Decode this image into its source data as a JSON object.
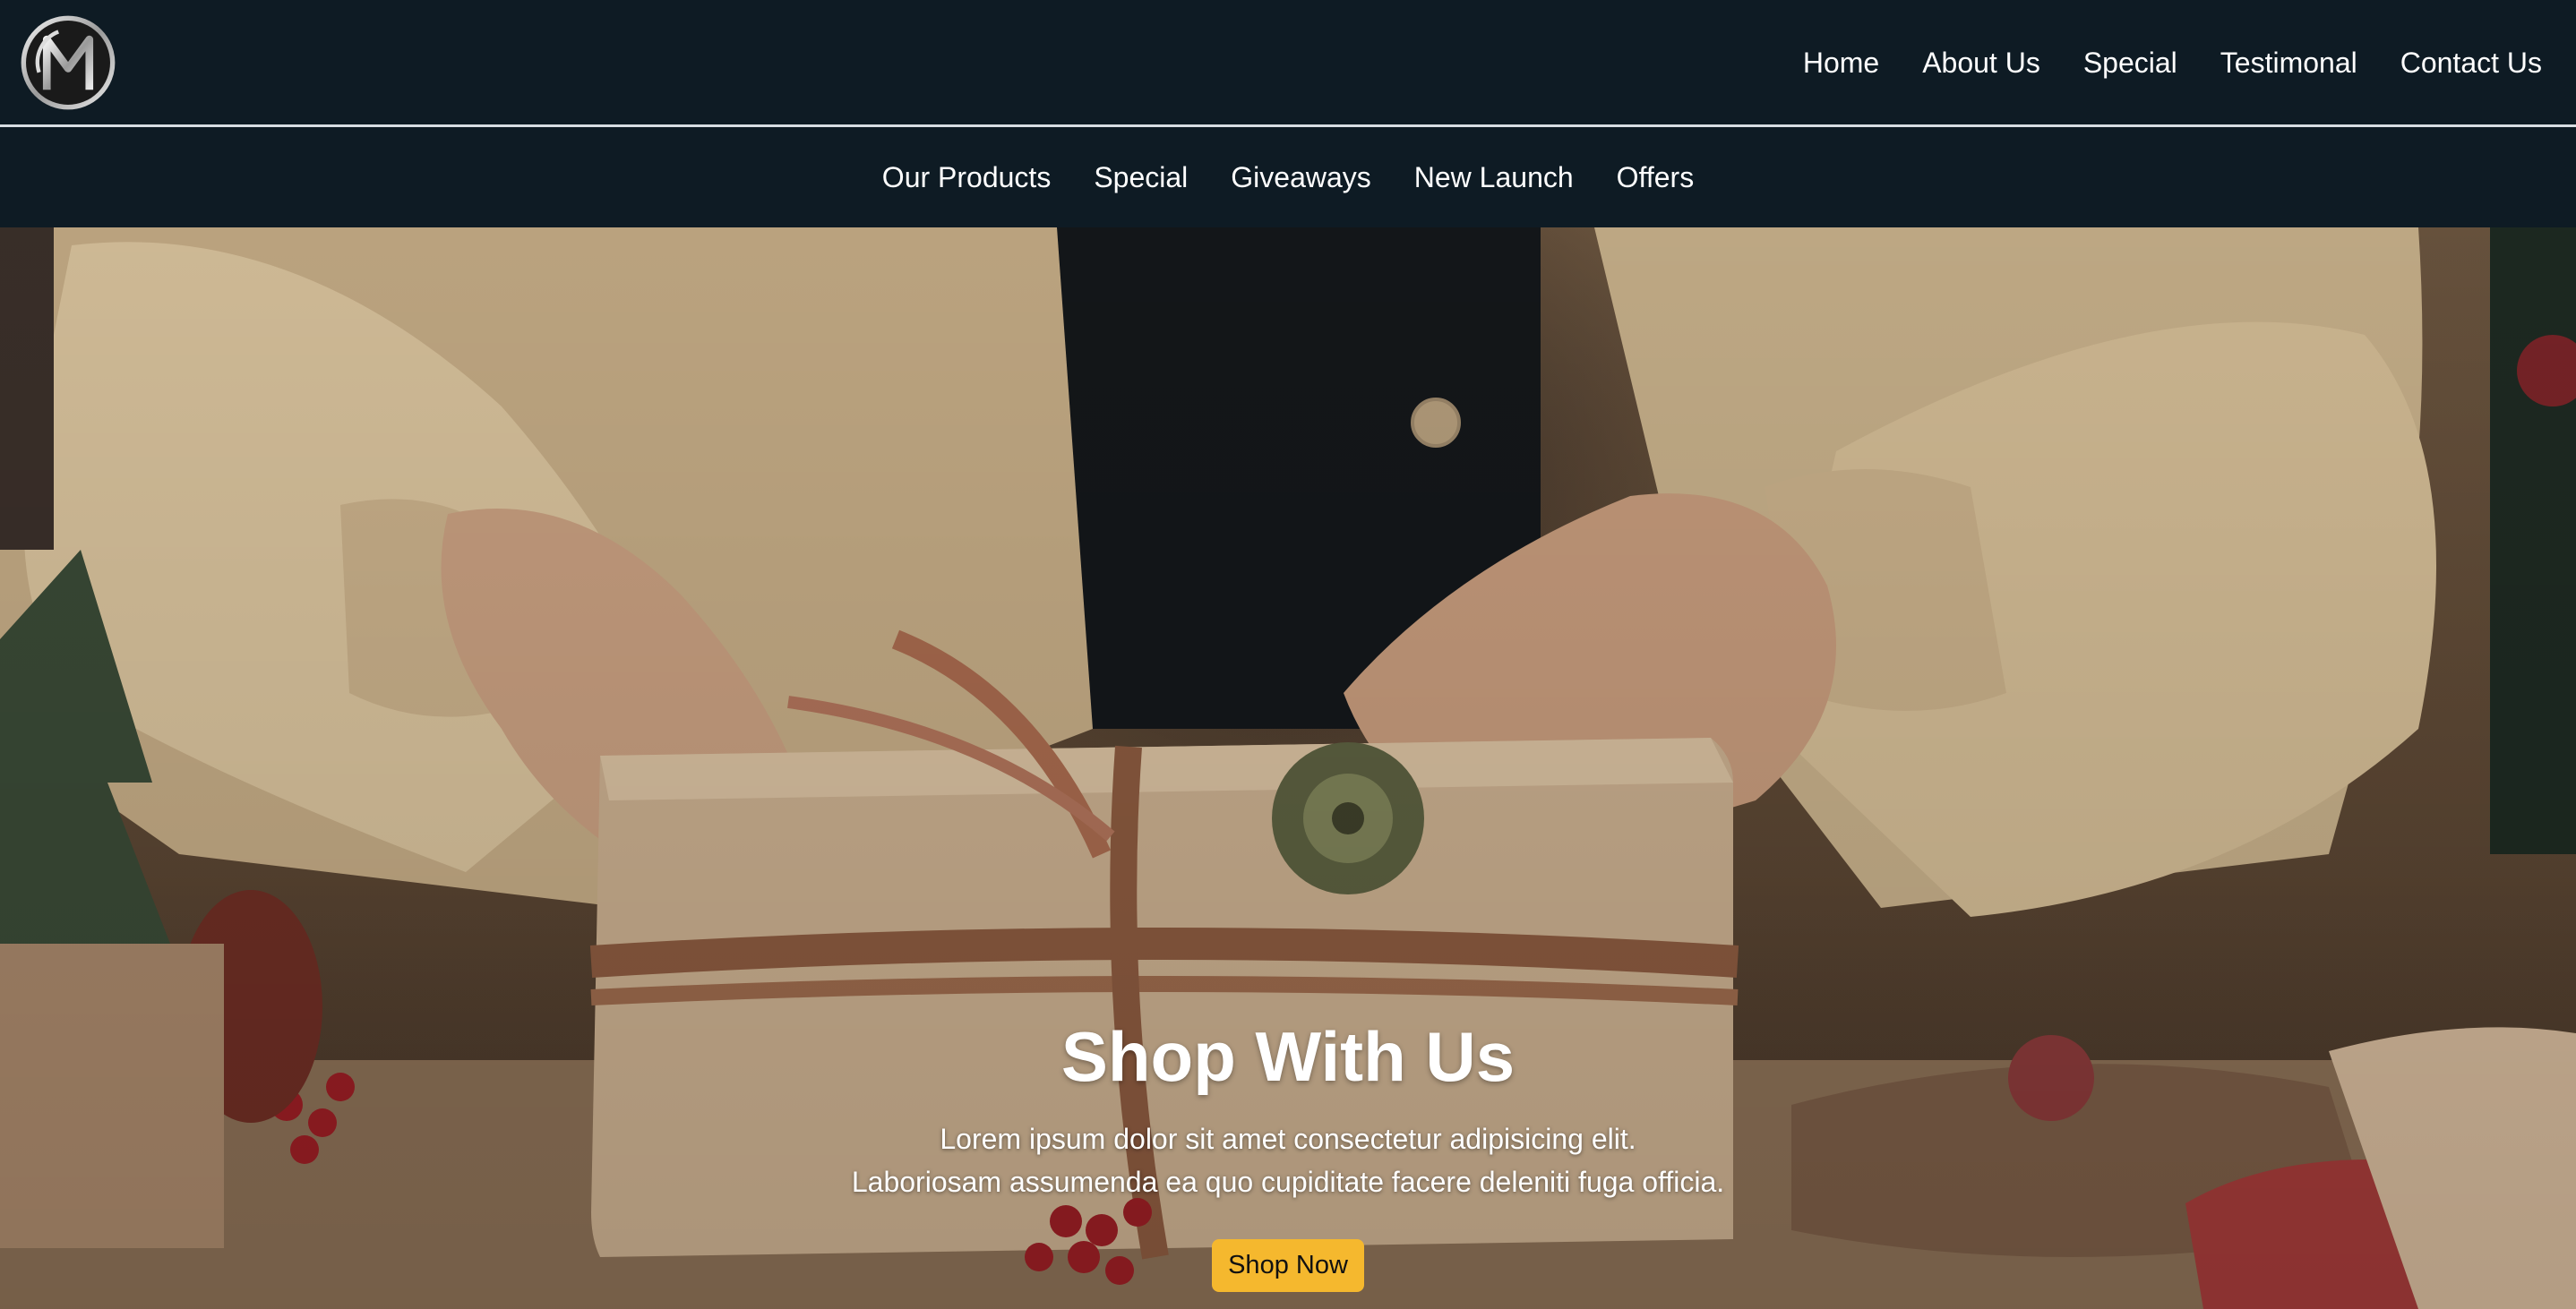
{
  "header": {
    "logo_icon": "m-monogram-logo-icon",
    "nav": [
      {
        "label": "Home"
      },
      {
        "label": "About Us"
      },
      {
        "label": "Special"
      },
      {
        "label": "Testimonal"
      },
      {
        "label": "Contact Us"
      }
    ]
  },
  "subnav": [
    {
      "label": "Our Products"
    },
    {
      "label": "Special"
    },
    {
      "label": "Giveaways"
    },
    {
      "label": "New Launch"
    },
    {
      "label": "Offers"
    }
  ],
  "hero": {
    "title": "Shop With Us",
    "text_line1": "Lorem ipsum dolor sit amet consectetur adipisicing elit.",
    "text_line2": "Laboriosam assumenda ea quo cupiditate facere deleniti fuga officia.",
    "button_label": "Shop Now",
    "image_subject": "hands wrapping a gift box with twine"
  },
  "colors": {
    "header_bg": "#0e1b24",
    "nav_text": "#ffffff",
    "button_bg": "#f5b82e",
    "button_text": "#111111"
  }
}
